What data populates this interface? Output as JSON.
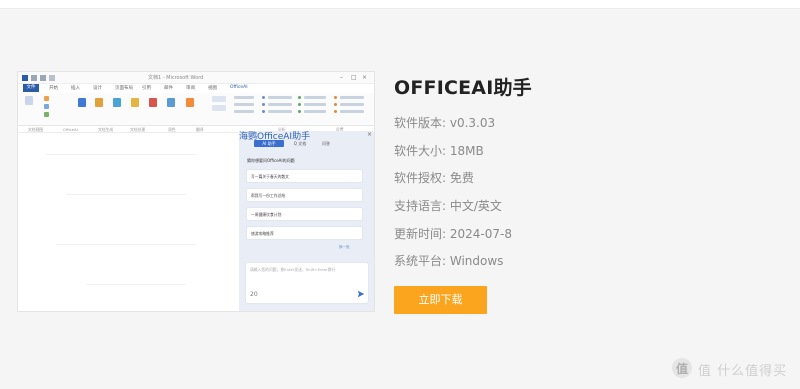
{
  "screenshot": {
    "window_title": "文档1 - Microsoft Word",
    "menu": [
      "文件",
      "开始",
      "插入",
      "设计",
      "页面布局",
      "引用",
      "邮件",
      "审阅",
      "视图",
      "OfficeAI"
    ],
    "groups": [
      "文档视图",
      "OfficeAI",
      "文档生成",
      "文档处理",
      "润色",
      "翻译",
      "分析",
      "设置"
    ],
    "ai_panel": {
      "title": "海鹦OfficeAI助手",
      "close": "×",
      "tabs": [
        "AI 助手",
        "Q 文档",
        "问答"
      ],
      "intro": "猜你想要问OfficeAI的问题",
      "suggestions": [
        "写一篇关于春天的散文",
        "帮我写一份工作总结",
        "一周健康饮食计划",
        "旅游攻略推荐"
      ],
      "more": "换一批",
      "input_placeholder": "请输入您的问题，按Enter发送，Shift+Enter换行",
      "char_count": "20"
    }
  },
  "info": {
    "title": "OFFICEAI助手",
    "version": "软件版本: v0.3.03",
    "size": "软件大小: 18MB",
    "license": "软件授权: 免费",
    "language": "支持语言: 中文/英文",
    "updated": "更新时间: 2024-07-8",
    "platform": "系统平台: Windows",
    "download": "立即下载"
  },
  "watermark": {
    "text": "值 什么值得买"
  },
  "colors": {
    "accent": "#fba51f",
    "word_blue": "#2b5ca8",
    "ai_blue": "#3a6fd0",
    "panel_bg": "#e9eef6"
  }
}
